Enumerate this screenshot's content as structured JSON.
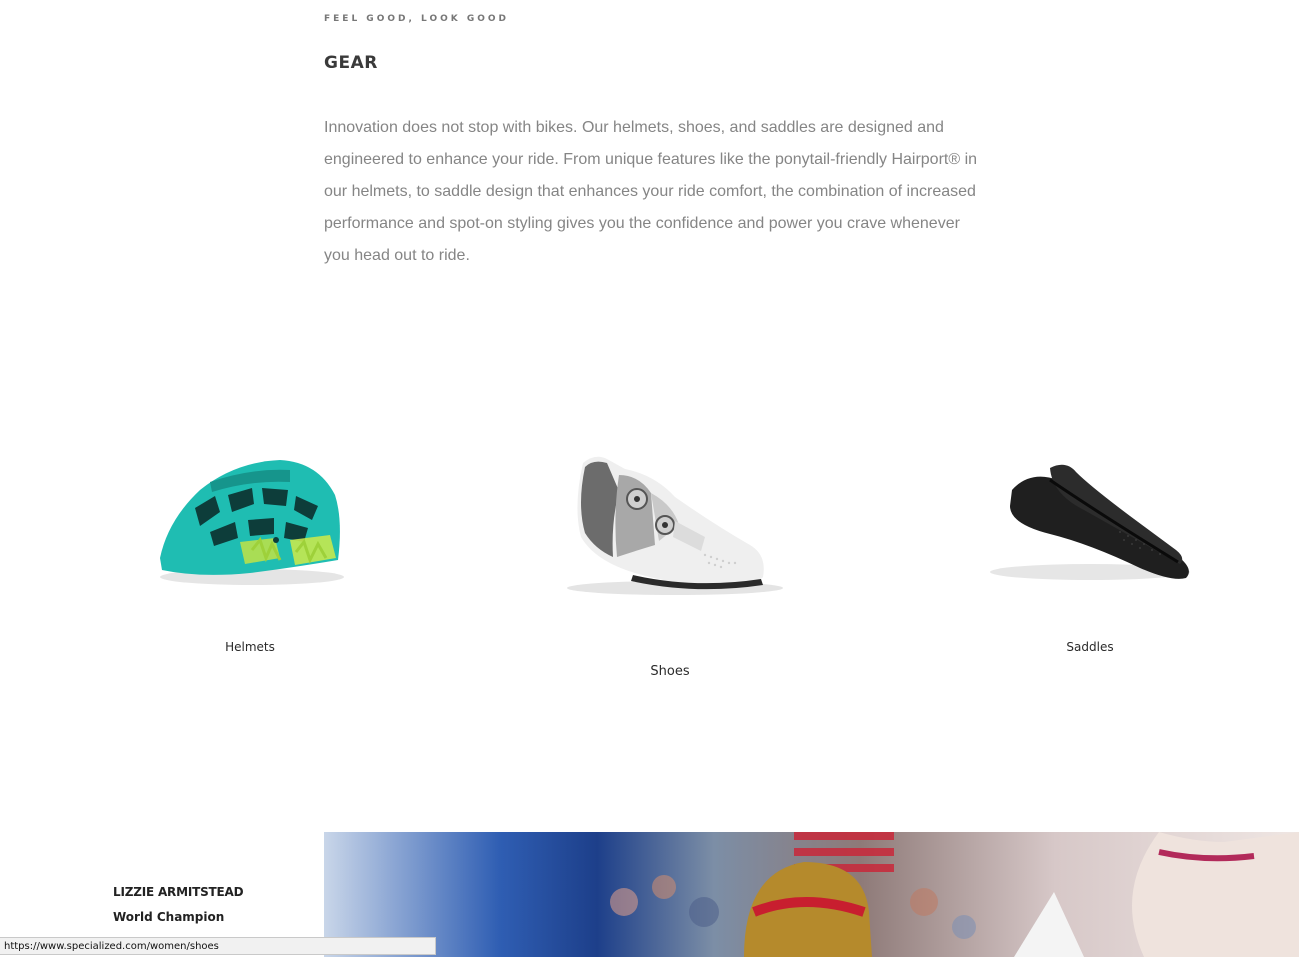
{
  "section": {
    "eyebrow": "FEEL GOOD, LOOK GOOD",
    "title": "GEAR",
    "intro": "Innovation does not stop with bikes. Our helmets, shoes, and saddles are designed and engineered to enhance your ride. From unique features like the ponytail-friendly Hairport® in our helmets, to saddle design that enhances your ride comfort, the combination of increased performance and spot-on styling gives you the confidence and power you crave whenever you head out to ride."
  },
  "products": {
    "helmets": {
      "label": "Helmets",
      "icon": "helmet-image",
      "color": "#21bfb3"
    },
    "shoes": {
      "label": "Shoes",
      "icon": "shoe-image",
      "color": "#e9e9e9"
    },
    "saddles": {
      "label": "Saddles",
      "icon": "saddle-image",
      "color": "#1e1e1e"
    }
  },
  "athlete": {
    "name": "LIZZIE ARMITSTEAD",
    "title": "World Champion"
  },
  "status_bar": {
    "url": "https://www.specialized.com/women/shoes"
  }
}
